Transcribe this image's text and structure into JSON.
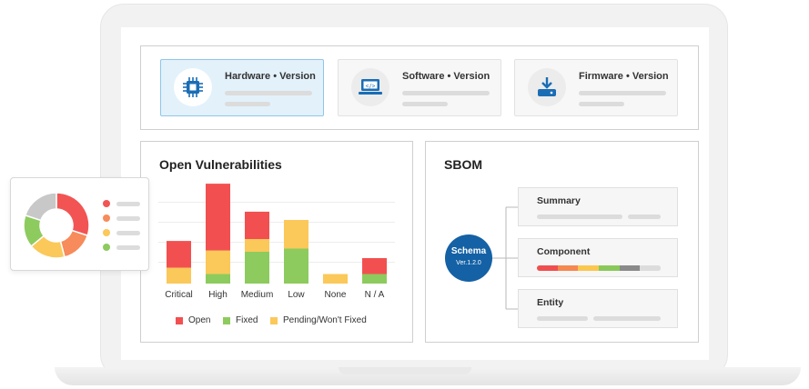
{
  "versions": [
    {
      "label": "Hardware • Version",
      "icon": "chip-icon",
      "active": true
    },
    {
      "label": "Software • Version",
      "icon": "laptop-code-icon",
      "active": false
    },
    {
      "label": "Firmware • Version",
      "icon": "download-device-icon",
      "active": false
    }
  ],
  "vulnerabilities": {
    "title": "Open Vulnerabilities",
    "legend": {
      "open": "Open",
      "fixed": "Fixed",
      "pending": "Pending/Won't Fixed"
    }
  },
  "chart_data": {
    "type": "bar",
    "stacked": true,
    "categories": [
      "Critical",
      "High",
      "Medium",
      "Low",
      "None",
      "N / A"
    ],
    "series": [
      {
        "name": "Fixed",
        "values": [
          0,
          1.5,
          5,
          5.5,
          0,
          1.5
        ]
      },
      {
        "name": "Pending/Won't Fixed",
        "values": [
          2.5,
          3.7,
          2,
          4.5,
          1.5,
          0
        ]
      },
      {
        "name": "Open",
        "values": [
          4.2,
          10.5,
          4.3,
          0,
          0,
          2.5
        ]
      }
    ],
    "colors": {
      "Open": "#f25050",
      "Fixed": "#8dcb5e",
      "Pending/Won't Fixed": "#fbc85a"
    },
    "ylim": [
      0,
      16
    ],
    "grid": true,
    "legend_position": "bottom"
  },
  "sbom": {
    "title": "SBOM",
    "schema": {
      "name": "Schema",
      "version": "Ver.1.2.0"
    },
    "items": [
      "Summary",
      "Component",
      "Entity"
    ],
    "component_colors": [
      "#f04e4e",
      "#f5874f",
      "#fbc74f",
      "#89c95b",
      "#8a8a8a"
    ]
  },
  "donut": {
    "segments": [
      {
        "value": 30,
        "color": "#f25454"
      },
      {
        "value": 16,
        "color": "#f78b5b"
      },
      {
        "value": 18,
        "color": "#fbc85a"
      },
      {
        "value": 16,
        "color": "#8dcb5e"
      },
      {
        "value": 20,
        "color": "#c8c8c8"
      }
    ],
    "legend_colors": [
      "#f25454",
      "#f78b5b",
      "#fbc85a",
      "#8dcb5e"
    ]
  }
}
